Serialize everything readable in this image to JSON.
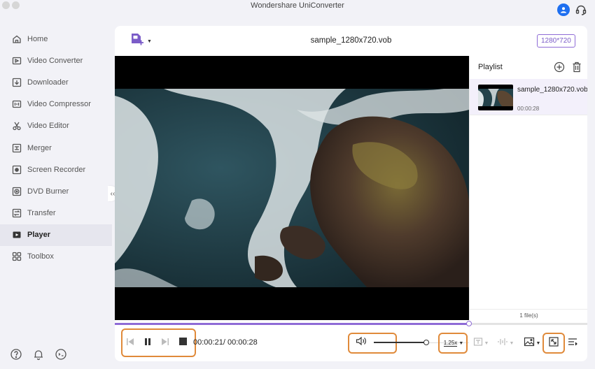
{
  "app": {
    "title": "Wondershare UniConverter"
  },
  "sidebar": {
    "items": [
      {
        "label": "Home",
        "icon": "home-icon"
      },
      {
        "label": "Video Converter",
        "icon": "video-converter-icon"
      },
      {
        "label": "Downloader",
        "icon": "downloader-icon"
      },
      {
        "label": "Video Compressor",
        "icon": "video-compressor-icon"
      },
      {
        "label": "Video Editor",
        "icon": "scissors-icon"
      },
      {
        "label": "Merger",
        "icon": "merger-icon"
      },
      {
        "label": "Screen Recorder",
        "icon": "screen-recorder-icon"
      },
      {
        "label": "DVD Burner",
        "icon": "disc-icon"
      },
      {
        "label": "Transfer",
        "icon": "transfer-icon"
      },
      {
        "label": "Player",
        "icon": "player-icon",
        "active": true
      },
      {
        "label": "Toolbox",
        "icon": "toolbox-icon"
      }
    ],
    "footer_icons": [
      "help-icon",
      "bell-icon",
      "feedback-icon"
    ]
  },
  "player": {
    "file_title": "sample_1280x720.vob",
    "resolution": "1280*720",
    "current_time": "00:00:21",
    "separator": "/ ",
    "total_time": "00:00:28",
    "progress_fraction": 0.75,
    "volume_fraction": 0.55,
    "speed": "1.25x"
  },
  "playlist": {
    "title": "Playlist",
    "items": [
      {
        "name": "sample_1280x720.vob",
        "duration": "00:00:28"
      }
    ],
    "count_label": "1 file(s)"
  },
  "colors": {
    "accent": "#8e6bd6",
    "highlight": "#e08a3a",
    "account_blue": "#1e6ff0"
  }
}
